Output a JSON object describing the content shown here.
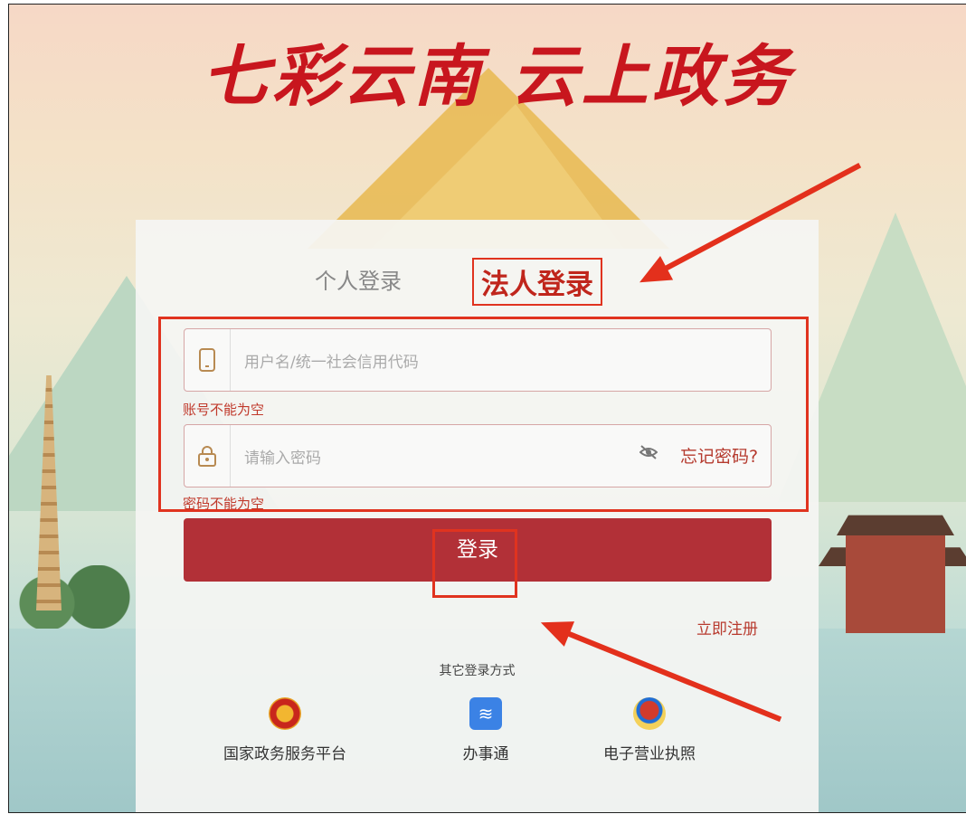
{
  "header": {
    "headline": "七彩云南 云上政务"
  },
  "tabs": {
    "personal": "个人登录",
    "legal": "法人登录"
  },
  "form": {
    "username_placeholder": "用户名/统一社会信用代码",
    "username_error": "账号不能为空",
    "password_placeholder": "请输入密码",
    "password_error": "密码不能为空",
    "forgot_password": "忘记密码?",
    "login_button": "登录",
    "register_link": "立即注册"
  },
  "other_login": {
    "label": "其它登录方式",
    "options": [
      "国家政务服务平台",
      "办事通",
      "电子营业执照"
    ]
  },
  "icons": {
    "user_field": "phone-icon",
    "password_field": "lock-icon",
    "toggle_visibility": "eye-off-icon",
    "option_1": "national-emblem-icon",
    "option_2": "bst-app-icon",
    "option_3": "license-emblem-icon"
  },
  "colors": {
    "brand_red": "#c0261c",
    "button_red": "#b23037",
    "annotation_red": "#e0331f"
  }
}
